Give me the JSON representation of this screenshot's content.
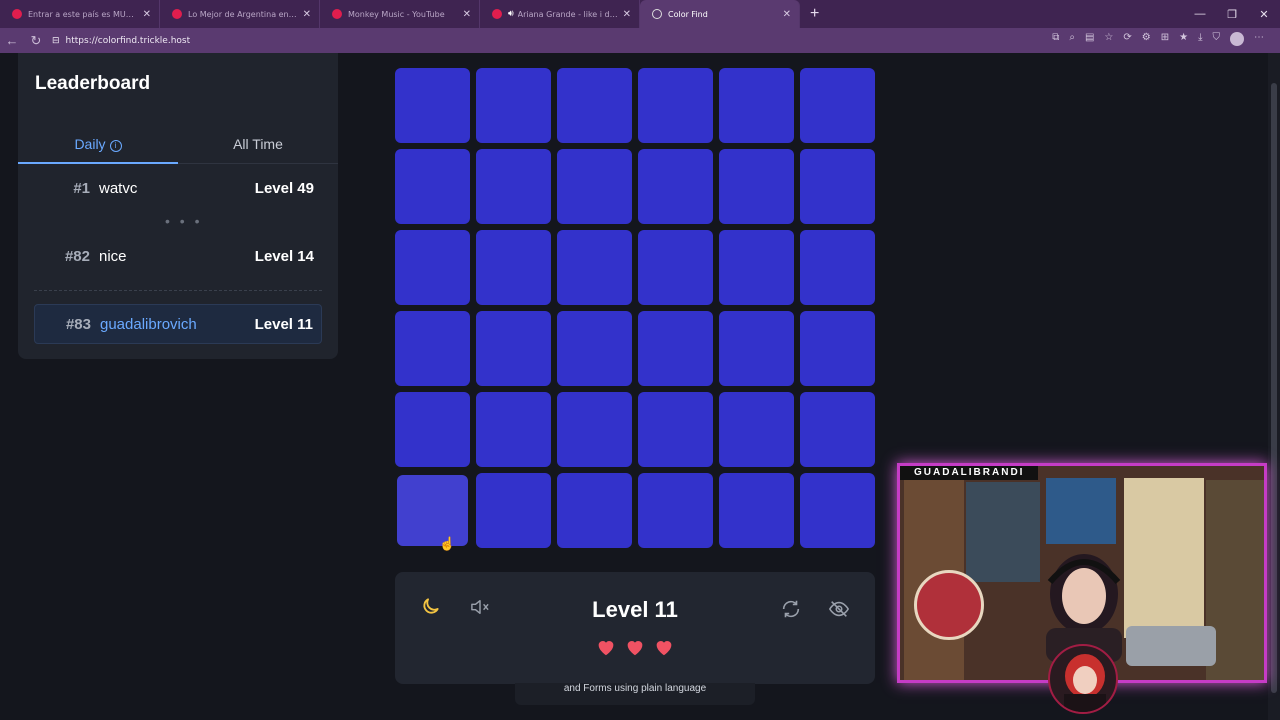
{
  "browser": {
    "tabs": [
      {
        "title": "Entrar a este país es MUY difícil y...",
        "active": false
      },
      {
        "title": "Lo Mejor de Argentina en el Mundo",
        "active": false
      },
      {
        "title": "Monkey Music - YouTube",
        "active": false
      },
      {
        "title": "Ariana Grande - like i do (offic...",
        "active": false
      },
      {
        "title": "Color Find",
        "active": true
      }
    ],
    "url": "https://colorfind.trickle.host"
  },
  "leaderboard": {
    "title": "Leaderboard",
    "tab_daily": "Daily",
    "tab_all_time": "All Time",
    "entries": [
      {
        "rank": "#1",
        "name": "watvc",
        "level": "Level 49"
      },
      {
        "rank": "#82",
        "name": "nice",
        "level": "Level 14"
      },
      {
        "rank": "#83",
        "name": "guadalibrovich",
        "level": "Level 11"
      }
    ],
    "ellipsis": "• • •"
  },
  "game": {
    "grid_rows": 6,
    "grid_cols": 6,
    "base_color": "#3332cb",
    "odd_color": "#4140cf",
    "odd_cell": {
      "row": 5,
      "col": 0
    },
    "level_label": "Level 11",
    "hearts": 3
  },
  "footer": {
    "text": "and Forms using plain language"
  },
  "webcam": {
    "label": "GUADALIBRANDI"
  },
  "colors": {
    "accent": "#6aa9ff",
    "heart": "#f05263",
    "moon": "#f5c542",
    "tab_bar": "#3f2451"
  }
}
